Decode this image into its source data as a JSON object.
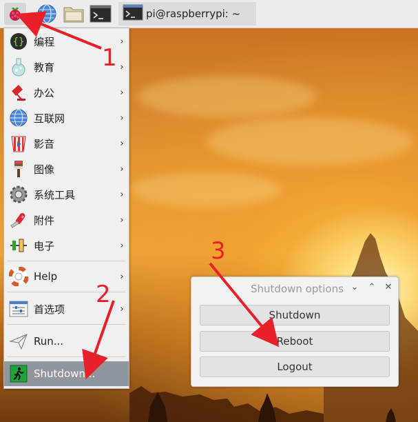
{
  "taskbar": {
    "launchers": [
      "raspberry-menu",
      "web-browser",
      "file-manager",
      "terminal"
    ],
    "task_title": "pi@raspberrypi: ~"
  },
  "menu": {
    "items": [
      {
        "label": "编程",
        "icon": "programming-icon",
        "has_submenu": true
      },
      {
        "label": "教育",
        "icon": "education-flask-icon",
        "has_submenu": true
      },
      {
        "label": "办公",
        "icon": "office-lamp-icon",
        "has_submenu": true
      },
      {
        "label": "互联网",
        "icon": "internet-globe-icon",
        "has_submenu": true
      },
      {
        "label": "影音",
        "icon": "sound-video-icon",
        "has_submenu": true
      },
      {
        "label": "图像",
        "icon": "graphics-brush-icon",
        "has_submenu": true
      },
      {
        "label": "系统工具",
        "icon": "system-tools-gear-icon",
        "has_submenu": true
      },
      {
        "label": "附件",
        "icon": "accessories-knife-icon",
        "has_submenu": true
      },
      {
        "label": "电子",
        "icon": "electronics-icon",
        "has_submenu": true
      },
      {
        "label": "Help",
        "icon": "help-lifebuoy-icon",
        "has_submenu": true
      },
      {
        "label": "首选项",
        "icon": "preferences-icon",
        "has_submenu": true
      },
      {
        "label": "Run...",
        "icon": "run-paper-plane-icon",
        "has_submenu": false
      },
      {
        "label": "Shutdown...",
        "icon": "shutdown-exit-icon",
        "has_submenu": false,
        "selected": true
      }
    ]
  },
  "dialog": {
    "title": "Shutdown options",
    "buttons": {
      "shutdown": "Shutdown",
      "reboot": "Reboot",
      "logout": "Logout"
    }
  },
  "annotations": {
    "step1": "1",
    "step2": "2",
    "step3": "3"
  },
  "colors": {
    "annotation_red": "#e8202a",
    "selected_item_bg": "#8f969d"
  }
}
